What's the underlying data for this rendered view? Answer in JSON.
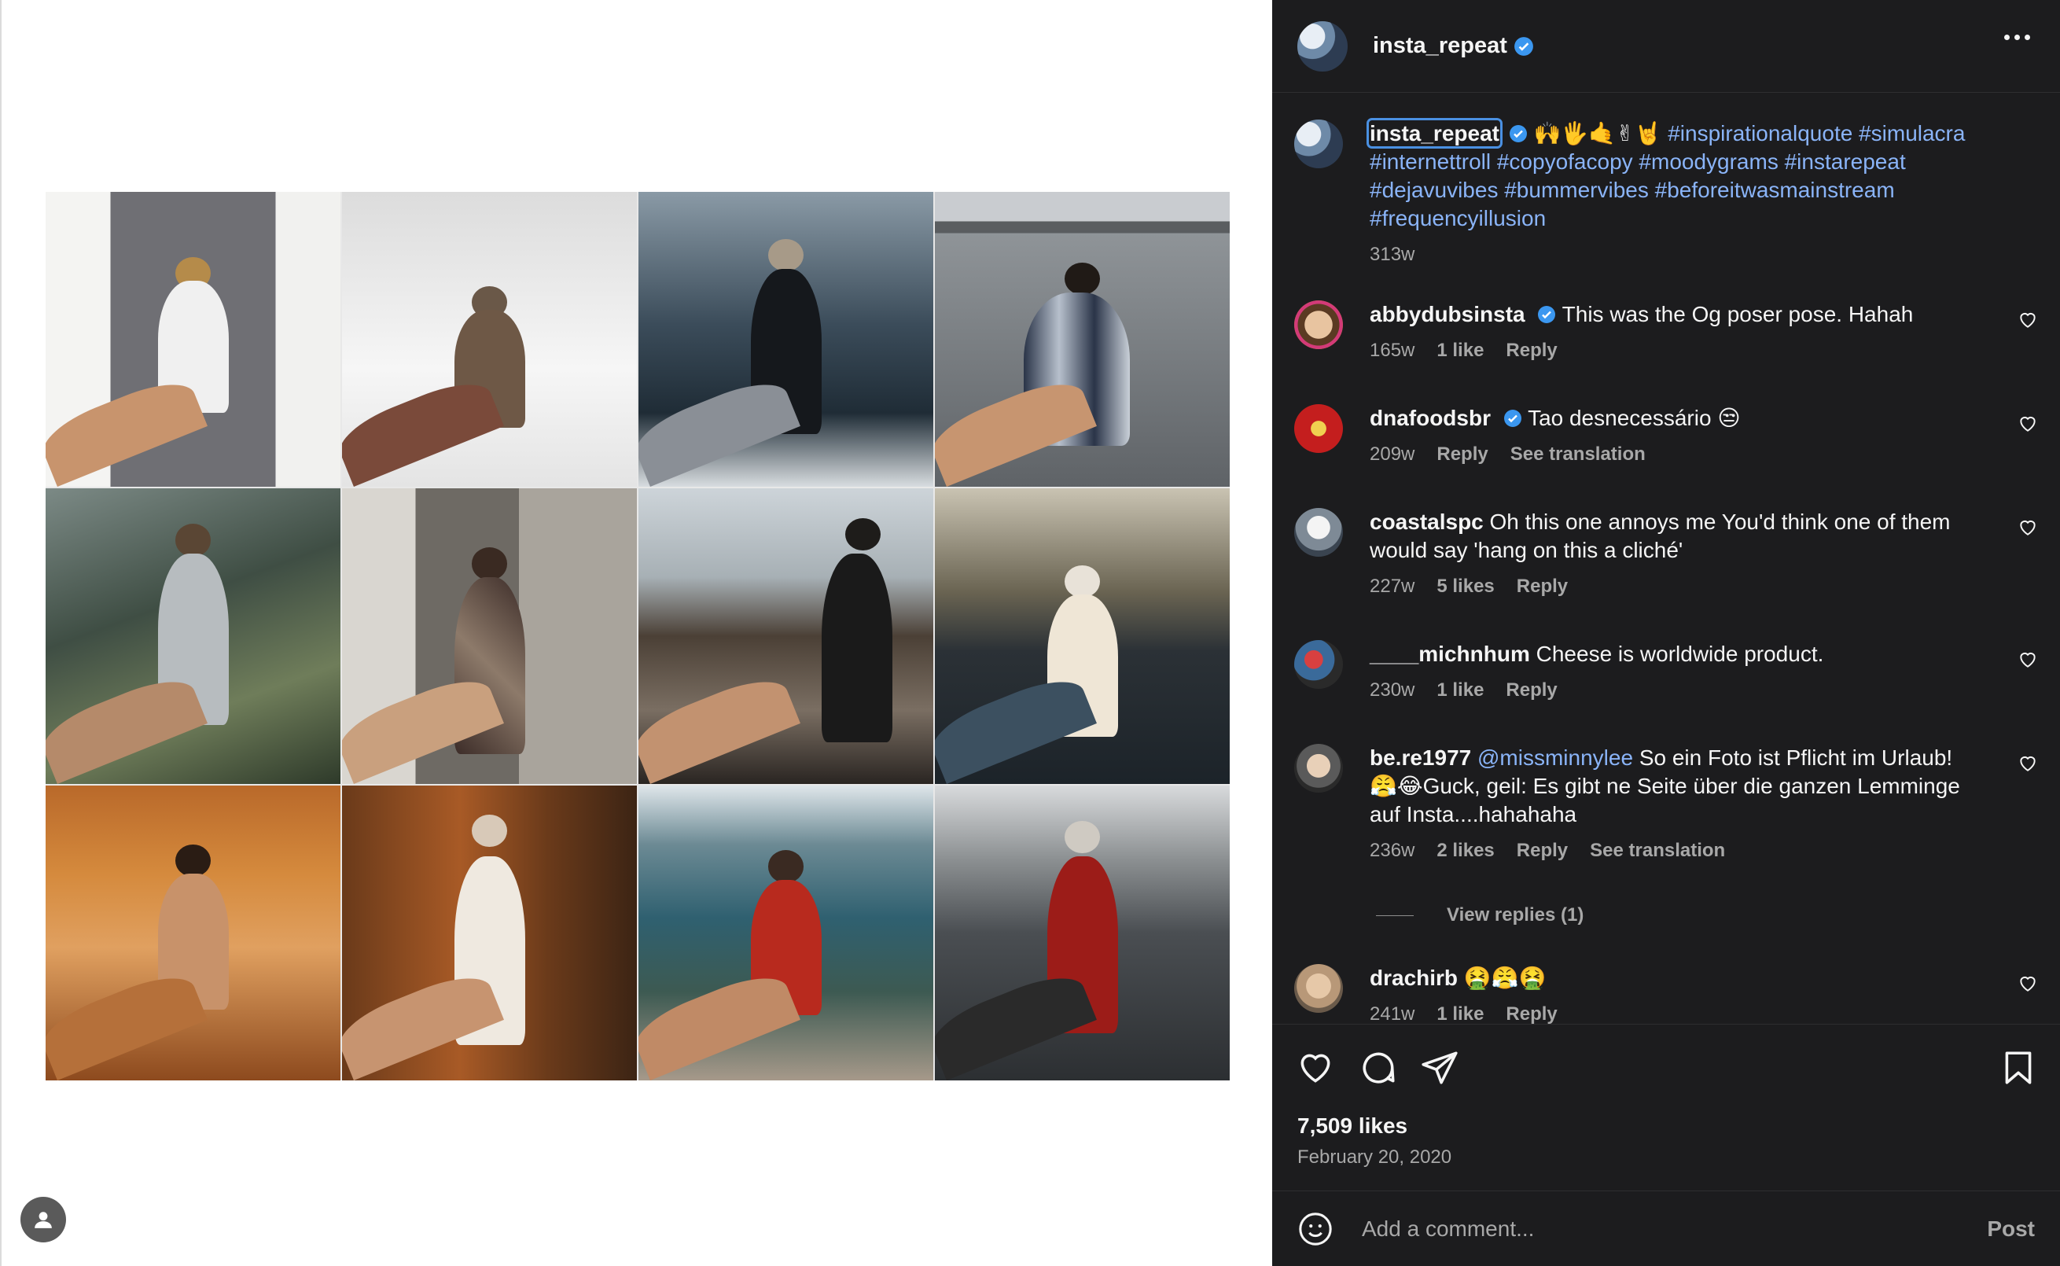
{
  "post": {
    "author": "insta_repeat",
    "caption_emojis": "🙌🖐🤙✌🤘",
    "caption_tags": "#inspirationalquote #simulacra #internettroll #copyofacopy #moodygrams #instarepeat #dejavuvibes #bummervibes #beforeitwasmainstream #frequencyillusion",
    "caption_time": "313w",
    "likes": "7,509 likes",
    "date": "February 20, 2020"
  },
  "comments": [
    {
      "user": "abbydubsinsta",
      "verified": true,
      "text": "This was the Og poser pose. Hahah",
      "time": "165w",
      "likes": "1 like",
      "reply": "Reply",
      "translate": ""
    },
    {
      "user": "dnafoodsbr",
      "verified": true,
      "text": "Tao desnecessário 😒",
      "time": "209w",
      "likes": "",
      "reply": "Reply",
      "translate": "See translation"
    },
    {
      "user": "coastalspc",
      "verified": false,
      "text": "Oh this one annoys me You'd think one of them would say 'hang on this a cliché'",
      "time": "227w",
      "likes": "5 likes",
      "reply": "Reply",
      "translate": ""
    },
    {
      "user": "____michnhum",
      "verified": false,
      "text": "Cheese is worldwide product.",
      "time": "230w",
      "likes": "1 like",
      "reply": "Reply",
      "translate": ""
    },
    {
      "user": "be.re1977",
      "verified": false,
      "mention": "@missminnylee",
      "text": "So ein Foto ist Pflicht im Urlaub! 😤😂Guck, geil: Es gibt ne Seite über die ganzen Lemminge auf Insta....hahahaha",
      "time": "236w",
      "likes": "2 likes",
      "reply": "Reply",
      "translate": "See translation"
    },
    {
      "user": "drachirb",
      "verified": false,
      "text": "🤮😤🤮",
      "time": "241w",
      "likes": "1 like",
      "reply": "Reply",
      "translate": ""
    }
  ],
  "view_replies": "View replies (1)",
  "composer": {
    "placeholder": "Add a comment...",
    "post_label": "Post"
  },
  "colors": {
    "sidebar_bg": "#1c1c1e",
    "link": "#8ab4f8",
    "verified": "#3b97f0",
    "muted": "#a8a8a8"
  },
  "icons": [
    "more-icon",
    "verified-icon",
    "heart-icon",
    "comment-icon",
    "share-icon",
    "bookmark-icon",
    "emoji-icon",
    "user-icon"
  ]
}
